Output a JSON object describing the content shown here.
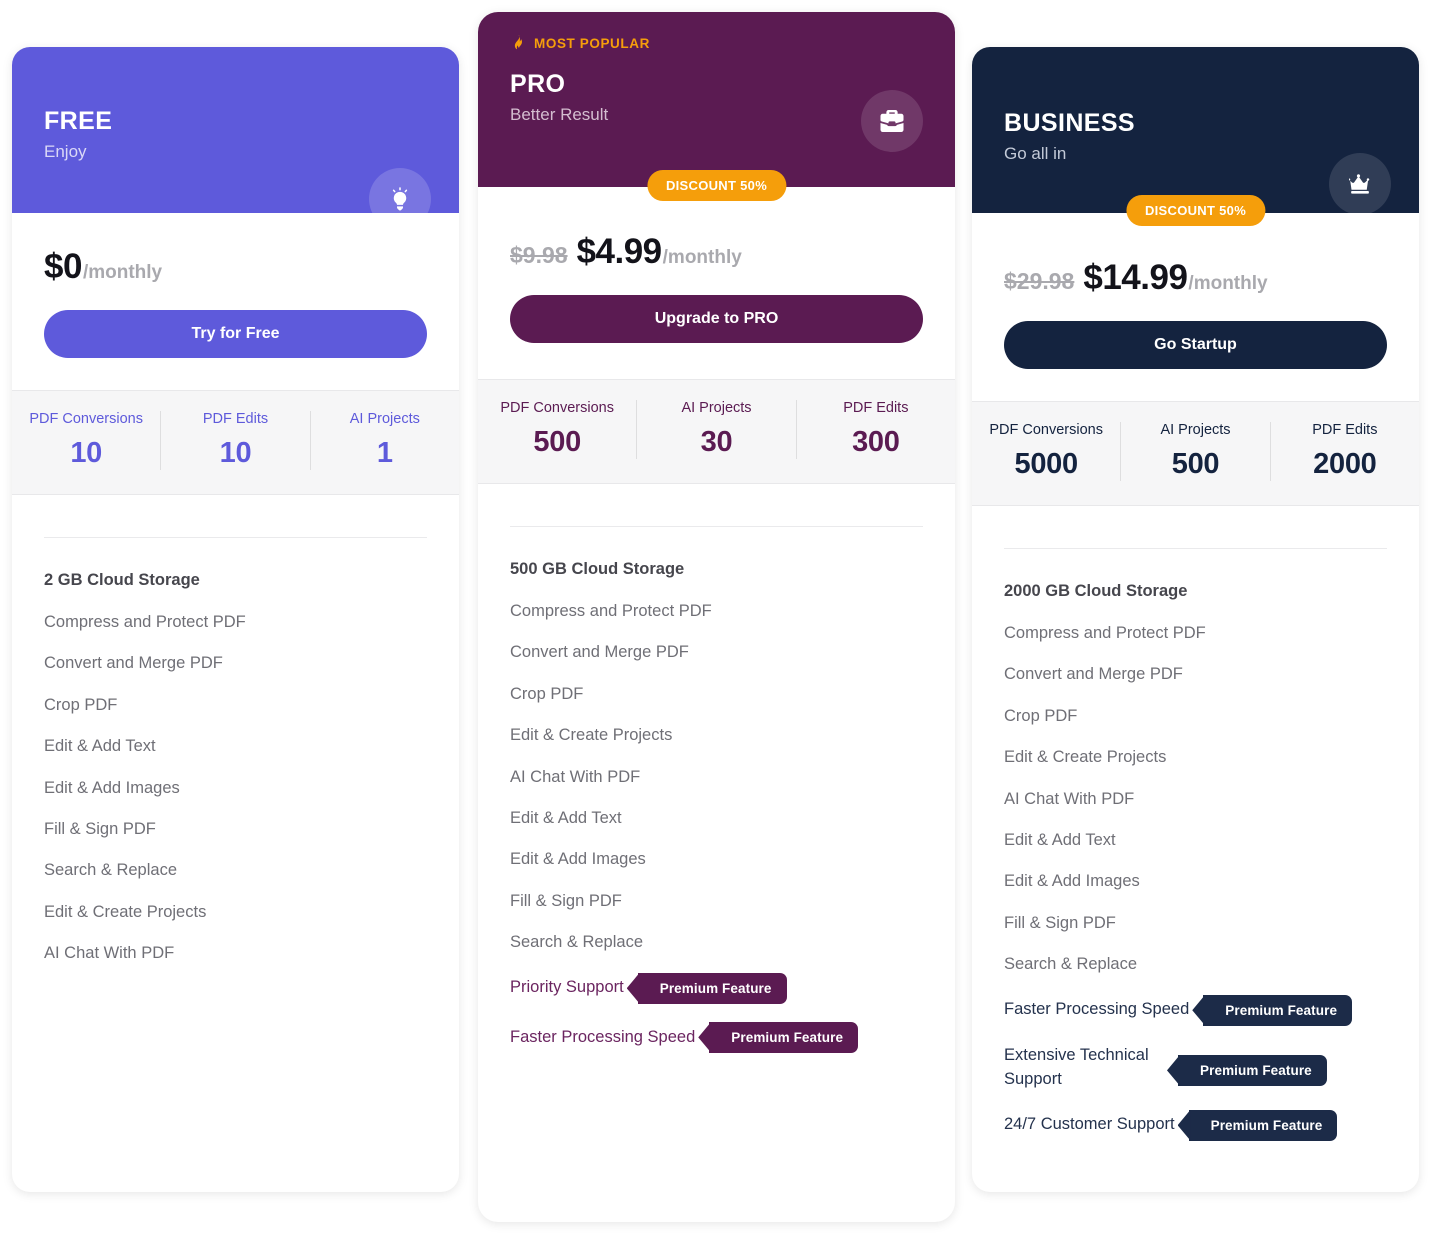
{
  "plans": [
    {
      "id": "free",
      "name": "FREE",
      "tagline": "Enjoy",
      "icon": "lightbulb-icon",
      "accent_color": "#5e5adb",
      "header_bg": "#5e5adb",
      "price_old": "",
      "price_now": "$0",
      "price_period": "/monthly",
      "discount_badge": "",
      "popular_label": "",
      "cta_label": "Try for Free",
      "stats": [
        {
          "label": "PDF Conversions",
          "value": "10"
        },
        {
          "label": "PDF Edits",
          "value": "10"
        },
        {
          "label": "AI Projects",
          "value": "1"
        }
      ],
      "features": [
        {
          "text": "2 GB Cloud Storage",
          "storage": true,
          "premium": false
        },
        {
          "text": "Compress and Protect PDF",
          "storage": false,
          "premium": false
        },
        {
          "text": "Convert and Merge PDF",
          "storage": false,
          "premium": false
        },
        {
          "text": "Crop PDF",
          "storage": false,
          "premium": false
        },
        {
          "text": "Edit & Add Text",
          "storage": false,
          "premium": false
        },
        {
          "text": "Edit & Add Images",
          "storage": false,
          "premium": false
        },
        {
          "text": "Fill & Sign PDF",
          "storage": false,
          "premium": false
        },
        {
          "text": "Search & Replace",
          "storage": false,
          "premium": false
        },
        {
          "text": "Edit & Create Projects",
          "storage": false,
          "premium": false
        },
        {
          "text": "AI Chat With PDF",
          "storage": false,
          "premium": false
        }
      ]
    },
    {
      "id": "pro",
      "name": "PRO",
      "tagline": "Better Result",
      "icon": "briefcase-icon",
      "accent_color": "#5b1b52",
      "header_bg": "#5b1b52",
      "price_old": "$9.98",
      "price_now": "$4.99",
      "price_period": "/monthly",
      "discount_badge": "DISCOUNT 50%",
      "popular_label": "MOST POPULAR",
      "cta_label": "Upgrade to PRO",
      "stats": [
        {
          "label": "PDF Conversions",
          "value": "500"
        },
        {
          "label": "AI Projects",
          "value": "30"
        },
        {
          "label": "PDF Edits",
          "value": "300"
        }
      ],
      "features": [
        {
          "text": "500 GB Cloud Storage",
          "storage": true,
          "premium": false
        },
        {
          "text": "Compress and Protect PDF",
          "storage": false,
          "premium": false
        },
        {
          "text": "Convert and Merge PDF",
          "storage": false,
          "premium": false
        },
        {
          "text": "Crop PDF",
          "storage": false,
          "premium": false
        },
        {
          "text": "Edit & Create Projects",
          "storage": false,
          "premium": false
        },
        {
          "text": "AI Chat With PDF",
          "storage": false,
          "premium": false
        },
        {
          "text": "Edit & Add Text",
          "storage": false,
          "premium": false
        },
        {
          "text": "Edit & Add Images",
          "storage": false,
          "premium": false
        },
        {
          "text": "Fill & Sign PDF",
          "storage": false,
          "premium": false
        },
        {
          "text": "Search & Replace",
          "storage": false,
          "premium": false
        },
        {
          "text": "Priority Support",
          "storage": false,
          "premium": true,
          "tag": "Premium Feature"
        },
        {
          "text": "Faster Processing Speed",
          "storage": false,
          "premium": true,
          "tag": "Premium Feature"
        }
      ]
    },
    {
      "id": "business",
      "name": "BUSINESS",
      "tagline": "Go all in",
      "icon": "crown-icon",
      "accent_color": "#14233f",
      "header_bg": "#14233f",
      "price_old": "$29.98",
      "price_now": "$14.99",
      "price_period": "/monthly",
      "discount_badge": "DISCOUNT 50%",
      "popular_label": "",
      "cta_label": "Go Startup",
      "stats": [
        {
          "label": "PDF Conversions",
          "value": "5000"
        },
        {
          "label": "AI Projects",
          "value": "500"
        },
        {
          "label": "PDF Edits",
          "value": "2000"
        }
      ],
      "features": [
        {
          "text": "2000 GB Cloud Storage",
          "storage": true,
          "premium": false
        },
        {
          "text": "Compress and Protect PDF",
          "storage": false,
          "premium": false
        },
        {
          "text": "Convert and Merge PDF",
          "storage": false,
          "premium": false
        },
        {
          "text": "Crop PDF",
          "storage": false,
          "premium": false
        },
        {
          "text": "Edit & Create Projects",
          "storage": false,
          "premium": false
        },
        {
          "text": "AI Chat With PDF",
          "storage": false,
          "premium": false
        },
        {
          "text": "Edit & Add Text",
          "storage": false,
          "premium": false
        },
        {
          "text": "Edit & Add Images",
          "storage": false,
          "premium": false
        },
        {
          "text": "Fill & Sign PDF",
          "storage": false,
          "premium": false
        },
        {
          "text": "Search & Replace",
          "storage": false,
          "premium": false
        },
        {
          "text": "Faster Processing Speed",
          "storage": false,
          "premium": true,
          "tag": "Premium Feature"
        },
        {
          "text": "Extensive Technical Support",
          "storage": false,
          "premium": true,
          "tag": "Premium Feature",
          "wrap": true
        },
        {
          "text": "24/7 Customer Support",
          "storage": false,
          "premium": true,
          "tag": "Premium Feature"
        }
      ]
    }
  ],
  "colors": {
    "free_accent": "#5e5adb",
    "pro_accent": "#5b1b52",
    "business_accent": "#14233f",
    "discount_orange": "#f59e0b",
    "feature_text": "#6f6f76",
    "price_old": "#a9a9ae"
  }
}
